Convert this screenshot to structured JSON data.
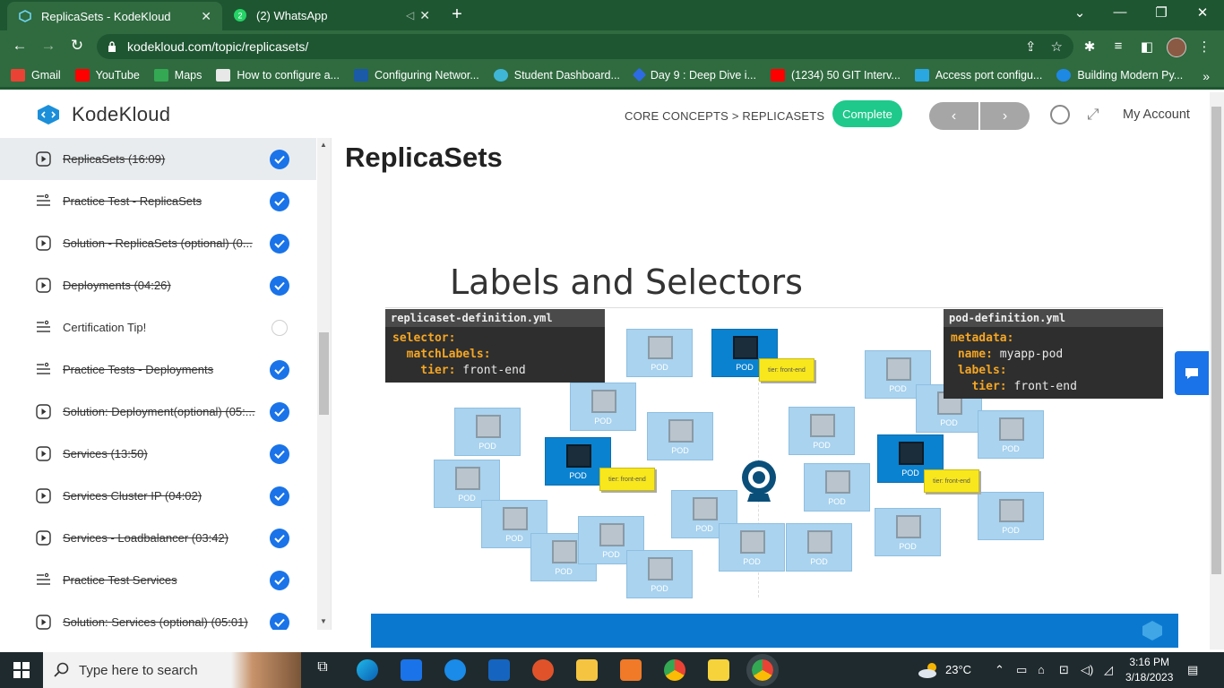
{
  "browser": {
    "tabs": [
      {
        "title": "ReplicaSets - KodeKloud",
        "active": true
      },
      {
        "title": "(2) WhatsApp",
        "active": false
      }
    ],
    "url": "kodekloud.com/topic/replicasets/",
    "bookmarks": [
      {
        "label": "Gmail",
        "color": "#ea4335"
      },
      {
        "label": "YouTube",
        "color": "#ff0000"
      },
      {
        "label": "Maps",
        "color": "#34a853"
      },
      {
        "label": "How to configure a...",
        "color": "#e8e8e8"
      },
      {
        "label": "Configuring Networ...",
        "color": "#1a5aa6"
      },
      {
        "label": "Student Dashboard...",
        "color": "#3fb6d6"
      },
      {
        "label": "Day 9 : Deep Dive i...",
        "color": "#2d6be4"
      },
      {
        "label": "(1234) 50 GIT Interv...",
        "color": "#ff0000"
      },
      {
        "label": "Access port configu...",
        "color": "#2aa7e0"
      },
      {
        "label": "Building Modern Py...",
        "color": "#1e88e5"
      }
    ]
  },
  "header": {
    "logo_text": "KodeKloud",
    "breadcrumb": "CORE CONCEPTS > REPLICASETS",
    "complete_label": "Complete",
    "prev_label": "‹",
    "next_label": "›",
    "account_label": "My Account"
  },
  "sidebar": {
    "items": [
      {
        "label": "ReplicaSets (16:09)",
        "type": "video",
        "done": true,
        "current": true
      },
      {
        "label": "Practice Test - ReplicaSets",
        "type": "lab",
        "done": true
      },
      {
        "label": "Solution - ReplicaSets (optional) (0...",
        "type": "video",
        "done": true
      },
      {
        "label": "Deployments (04:26)",
        "type": "video",
        "done": true
      },
      {
        "label": "Certification Tip!",
        "type": "lab",
        "done": false
      },
      {
        "label": "Practice Tests - Deployments",
        "type": "lab",
        "done": true
      },
      {
        "label": "Solution: Deployment(optional) (05:...",
        "type": "video",
        "done": true
      },
      {
        "label": "Services (13:50)",
        "type": "video",
        "done": true
      },
      {
        "label": "Services Cluster IP (04:02)",
        "type": "video",
        "done": true
      },
      {
        "label": "Services - Loadbalancer (03:42)",
        "type": "video",
        "done": true
      },
      {
        "label": "Practice Test Services",
        "type": "lab",
        "done": true
      },
      {
        "label": "Solution: Services (optional) (05:01)",
        "type": "video",
        "done": true
      }
    ]
  },
  "main": {
    "title": "ReplicaSets",
    "slide": {
      "title": "Labels and Selectors",
      "left_code": {
        "filename": "replicaset-definition.yml",
        "lines": [
          {
            "key": "selector:",
            "value": ""
          },
          {
            "key": "  matchLabels:",
            "value": ""
          },
          {
            "key": "    tier:",
            "value": " front-end"
          }
        ]
      },
      "right_code": {
        "filename": "pod-definition.yml",
        "lines": [
          {
            "key": "metadata:",
            "value": ""
          },
          {
            "key": " name:",
            "value": " myapp-pod"
          },
          {
            "key": " labels:",
            "value": ""
          },
          {
            "key": "   tier:",
            "value": " front-end"
          }
        ]
      },
      "pod_label": "POD",
      "tag_label": "tier: front-end"
    }
  },
  "taskbar": {
    "search_placeholder": "Type here to search",
    "weather": "23°C",
    "time": "3:16 PM",
    "date": "3/18/2023"
  }
}
